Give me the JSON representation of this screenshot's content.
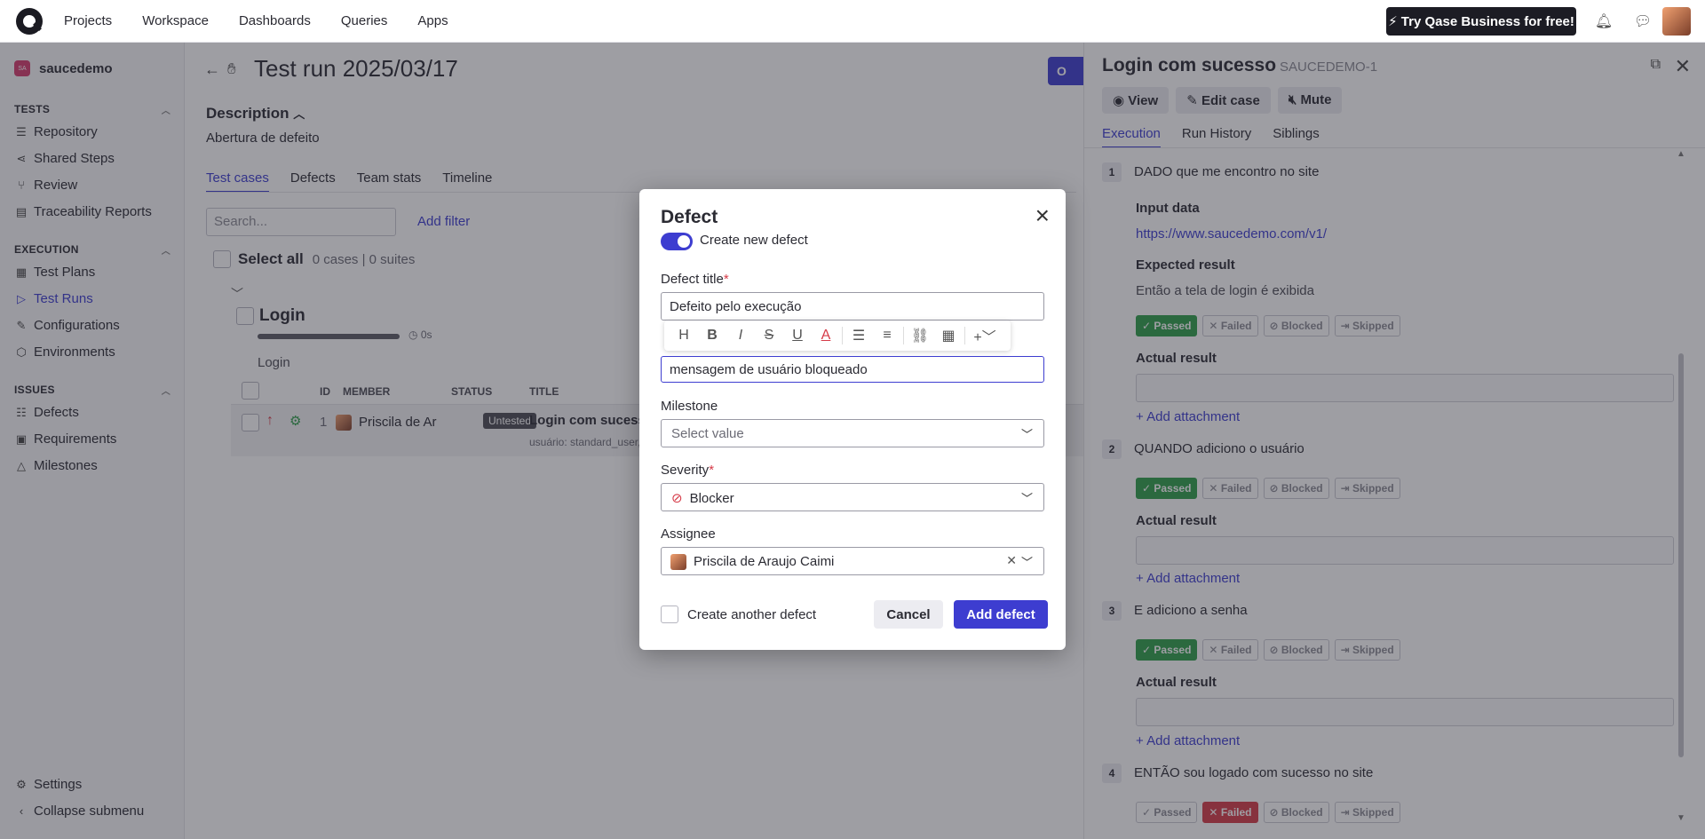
{
  "nav": {
    "items": [
      "Projects",
      "Workspace",
      "Dashboards",
      "Queries",
      "Apps"
    ],
    "try_button": "⚡ Try Qase Business for free!"
  },
  "sidebar": {
    "project_badge": "SA",
    "project_name": "saucedemo",
    "sections": {
      "tests": "TESTS",
      "execution": "EXECUTION",
      "issues": "ISSUES"
    },
    "items": {
      "repository": "Repository",
      "shared_steps": "Shared Steps",
      "review": "Review",
      "traceability": "Traceability Reports",
      "test_plans": "Test Plans",
      "test_runs": "Test Runs",
      "configurations": "Configurations",
      "environments": "Environments",
      "defects": "Defects",
      "requirements": "Requirements",
      "milestones": "Milestones",
      "settings": "Settings",
      "collapse": "Collapse submenu"
    }
  },
  "main": {
    "run_title": "Test run 2025/03/17",
    "description_title": "Description",
    "description_text": "Abertura de defeito",
    "tabs": [
      "Test cases",
      "Defects",
      "Team stats",
      "Timeline"
    ],
    "search_placeholder": "Search...",
    "add_filter": "Add filter",
    "select_all": "Select all",
    "select_counts": "0 cases | 0 suites",
    "suite_name": "Login",
    "suite_time": "0s",
    "suite_desc": "Login",
    "table_headers": {
      "id": "ID",
      "member": "MEMBER",
      "status": "STATUS",
      "title": "TITLE"
    },
    "row": {
      "id": "1",
      "member": "Priscila de Ar",
      "status": "Untested",
      "title": "Login com sucesso",
      "subtitle": "usuário: standard_user,"
    },
    "run_button": "O"
  },
  "panel": {
    "title": "Login com sucesso",
    "code": "SAUCEDEMO-1",
    "buttons": {
      "view": "View",
      "edit": "Edit case",
      "mute": "Mute"
    },
    "tabs": [
      "Execution",
      "Run History",
      "Siblings"
    ],
    "labels": {
      "input_data": "Input data",
      "expected_result": "Expected result",
      "actual_result": "Actual result",
      "add_attachment": "Add attachment"
    },
    "status_labels": {
      "passed": "Passed",
      "failed": "Failed",
      "blocked": "Blocked",
      "skipped": "Skipped"
    },
    "steps": [
      {
        "num": "1",
        "text": "DADO que me encontro no site",
        "input_data": "https://www.saucedemo.com/v1/",
        "expected": "Então a tela de login é exibida",
        "state": "passed"
      },
      {
        "num": "2",
        "text": "QUANDO adiciono o usuário",
        "state": "passed"
      },
      {
        "num": "3",
        "text": "E adiciono a senha",
        "state": "passed"
      },
      {
        "num": "4",
        "text": "ENTÃO sou logado com sucesso no site",
        "state": "failed"
      }
    ]
  },
  "modal": {
    "title": "Defect",
    "toggle_label": "Create new defect",
    "defect_title_label": "Defect title",
    "defect_title_value": "Defeito pelo execução",
    "description_value": "mensagem de usuário bloqueado",
    "milestone_label": "Milestone",
    "milestone_placeholder": "Select value",
    "severity_label": "Severity",
    "severity_value": "Blocker",
    "assignee_label": "Assignee",
    "assignee_value": "Priscila de Araujo Caimi",
    "create_another": "Create another defect",
    "cancel": "Cancel",
    "add": "Add defect"
  },
  "colors": {
    "accent": "#3d3dd0",
    "passed": "#2e9e49",
    "failed": "#d63b48"
  }
}
